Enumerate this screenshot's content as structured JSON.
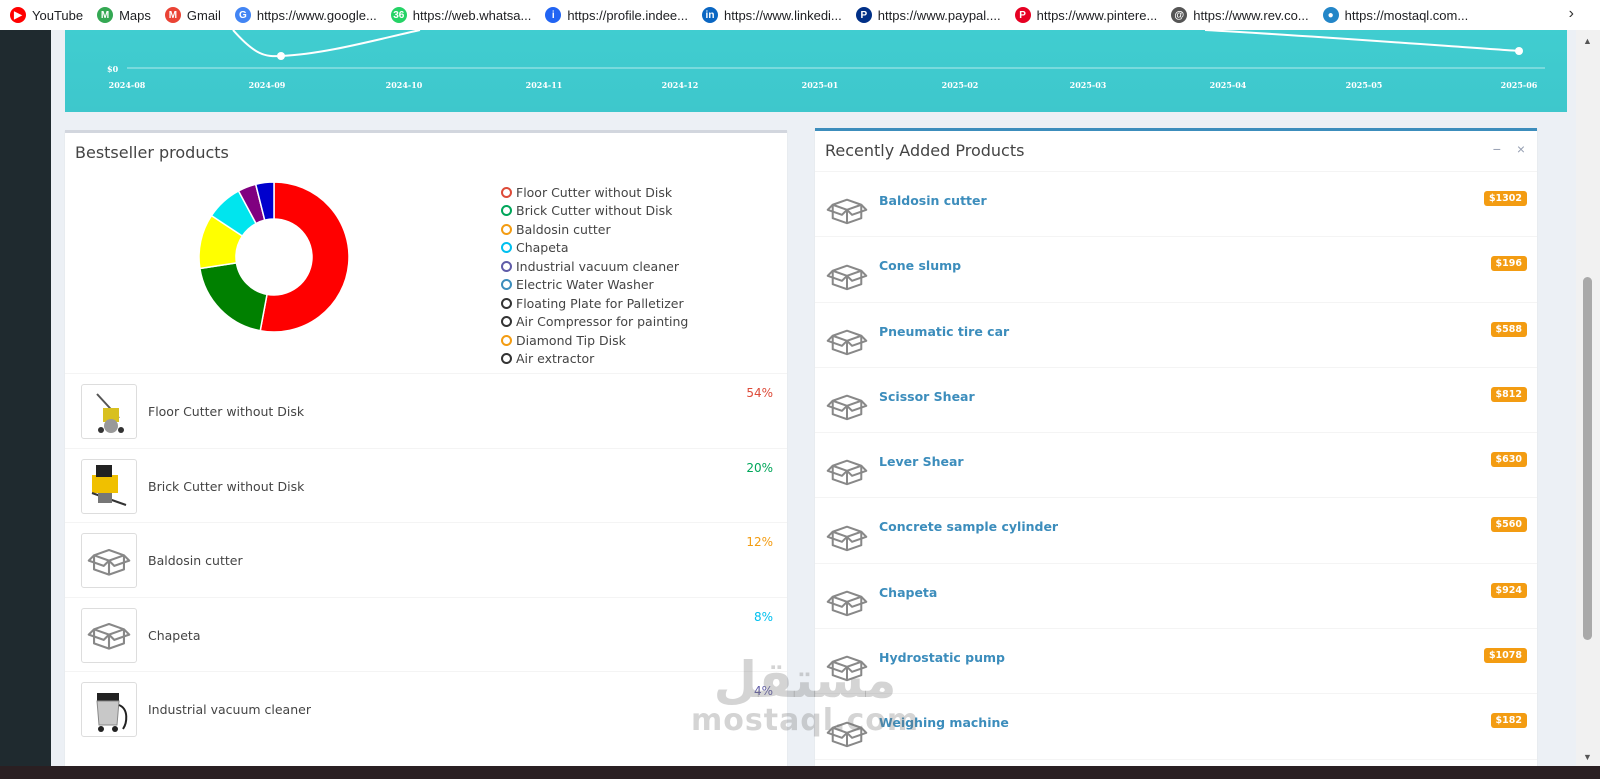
{
  "bookmarks": [
    {
      "label": "YouTube",
      "icon": "youtube-icon",
      "color": "#ff0000"
    },
    {
      "label": "Maps",
      "icon": "maps-icon",
      "color": "#34a853"
    },
    {
      "label": "Gmail",
      "icon": "gmail-icon",
      "color": "#ea4335"
    },
    {
      "label": "https://www.google...",
      "icon": "google-icon",
      "color": "#4285f4"
    },
    {
      "label": "https://web.whatsa...",
      "icon": "whatsapp-icon",
      "color": "#25d366"
    },
    {
      "label": "https://profile.indee...",
      "icon": "indeed-icon",
      "color": "#2164f3"
    },
    {
      "label": "https://www.linkedi...",
      "icon": "linkedin-icon",
      "color": "#0a66c2"
    },
    {
      "label": "https://www.paypal....",
      "icon": "paypal-icon",
      "color": "#003087"
    },
    {
      "label": "https://www.pintere...",
      "icon": "pinterest-icon",
      "color": "#e60023"
    },
    {
      "label": "https://www.rev.co...",
      "icon": "rev-icon",
      "color": "#555555"
    },
    {
      "label": "https://mostaql.com...",
      "icon": "mostaql-icon",
      "color": "#2386c8"
    }
  ],
  "sales_chart": {
    "y_label_zero": "$0",
    "x_ticks": [
      "2024-08",
      "2024-09",
      "2024-10",
      "2024-11",
      "2024-12",
      "2025-01",
      "2025-02",
      "2025-03",
      "2025-04",
      "2025-05",
      "2025-06"
    ]
  },
  "bestseller": {
    "title": "Bestseller products",
    "legend": [
      {
        "label": "Floor Cutter without Disk",
        "color": "#dd4b39"
      },
      {
        "label": "Brick Cutter without Disk",
        "color": "#00a65a"
      },
      {
        "label": "Baldosin cutter",
        "color": "#f39c12"
      },
      {
        "label": "Chapeta",
        "color": "#00c0ef"
      },
      {
        "label": "Industrial vacuum cleaner",
        "color": "#605ca8"
      },
      {
        "label": "Electric Water Washer",
        "color": "#3c8dbc"
      },
      {
        "label": "Floating Plate for Palletizer",
        "color": "#333333"
      },
      {
        "label": "Air Compressor for painting",
        "color": "#333333"
      },
      {
        "label": "Diamond Tip Disk",
        "color": "#f39c12"
      },
      {
        "label": "Air extractor",
        "color": "#333333"
      }
    ],
    "products": [
      {
        "name": "Floor Cutter without Disk",
        "pct": "54%",
        "pct_color": "#dd4b39",
        "thumb": "floor-cutter-photo"
      },
      {
        "name": "Brick Cutter without Disk",
        "pct": "20%",
        "pct_color": "#00a65a",
        "thumb": "brick-cutter-photo"
      },
      {
        "name": "Baldosin cutter",
        "pct": "12%",
        "pct_color": "#f39c12",
        "thumb": "box-icon"
      },
      {
        "name": "Chapeta",
        "pct": "8%",
        "pct_color": "#00c0ef",
        "thumb": "box-icon"
      },
      {
        "name": "Industrial vacuum cleaner",
        "pct": "4%",
        "pct_color": "#605ca8",
        "thumb": "vacuum-photo"
      }
    ]
  },
  "chart_data": {
    "type": "pie",
    "categories": [
      "Floor Cutter without Disk",
      "Brick Cutter without Disk",
      "Baldosin cutter",
      "Chapeta",
      "Industrial vacuum cleaner",
      "Electric Water Washer"
    ],
    "values": [
      54,
      20,
      12,
      8,
      4,
      4
    ],
    "colors": [
      "#ff0000",
      "#008000",
      "#ffff00",
      "#00e5ee",
      "#800080",
      "#0000cd"
    ],
    "donut": true,
    "legend": "right"
  },
  "recent": {
    "title": "Recently Added Products",
    "tools": {
      "collapse": "−",
      "close": "×"
    },
    "products": [
      {
        "name": "Baldosin cutter",
        "price": "$1302"
      },
      {
        "name": "Cone slump",
        "price": "$196"
      },
      {
        "name": "Pneumatic tire car",
        "price": "$588"
      },
      {
        "name": "Scissor Shear",
        "price": "$812"
      },
      {
        "name": "Lever Shear",
        "price": "$630"
      },
      {
        "name": "Concrete sample cylinder",
        "price": "$560"
      },
      {
        "name": "Chapeta",
        "price": "$924"
      },
      {
        "name": "Hydrostatic pump",
        "price": "$1078"
      },
      {
        "name": "Weighing machine",
        "price": "$182"
      }
    ]
  },
  "watermark": {
    "arabic": "مستقل",
    "latin": "mostaql.com"
  }
}
